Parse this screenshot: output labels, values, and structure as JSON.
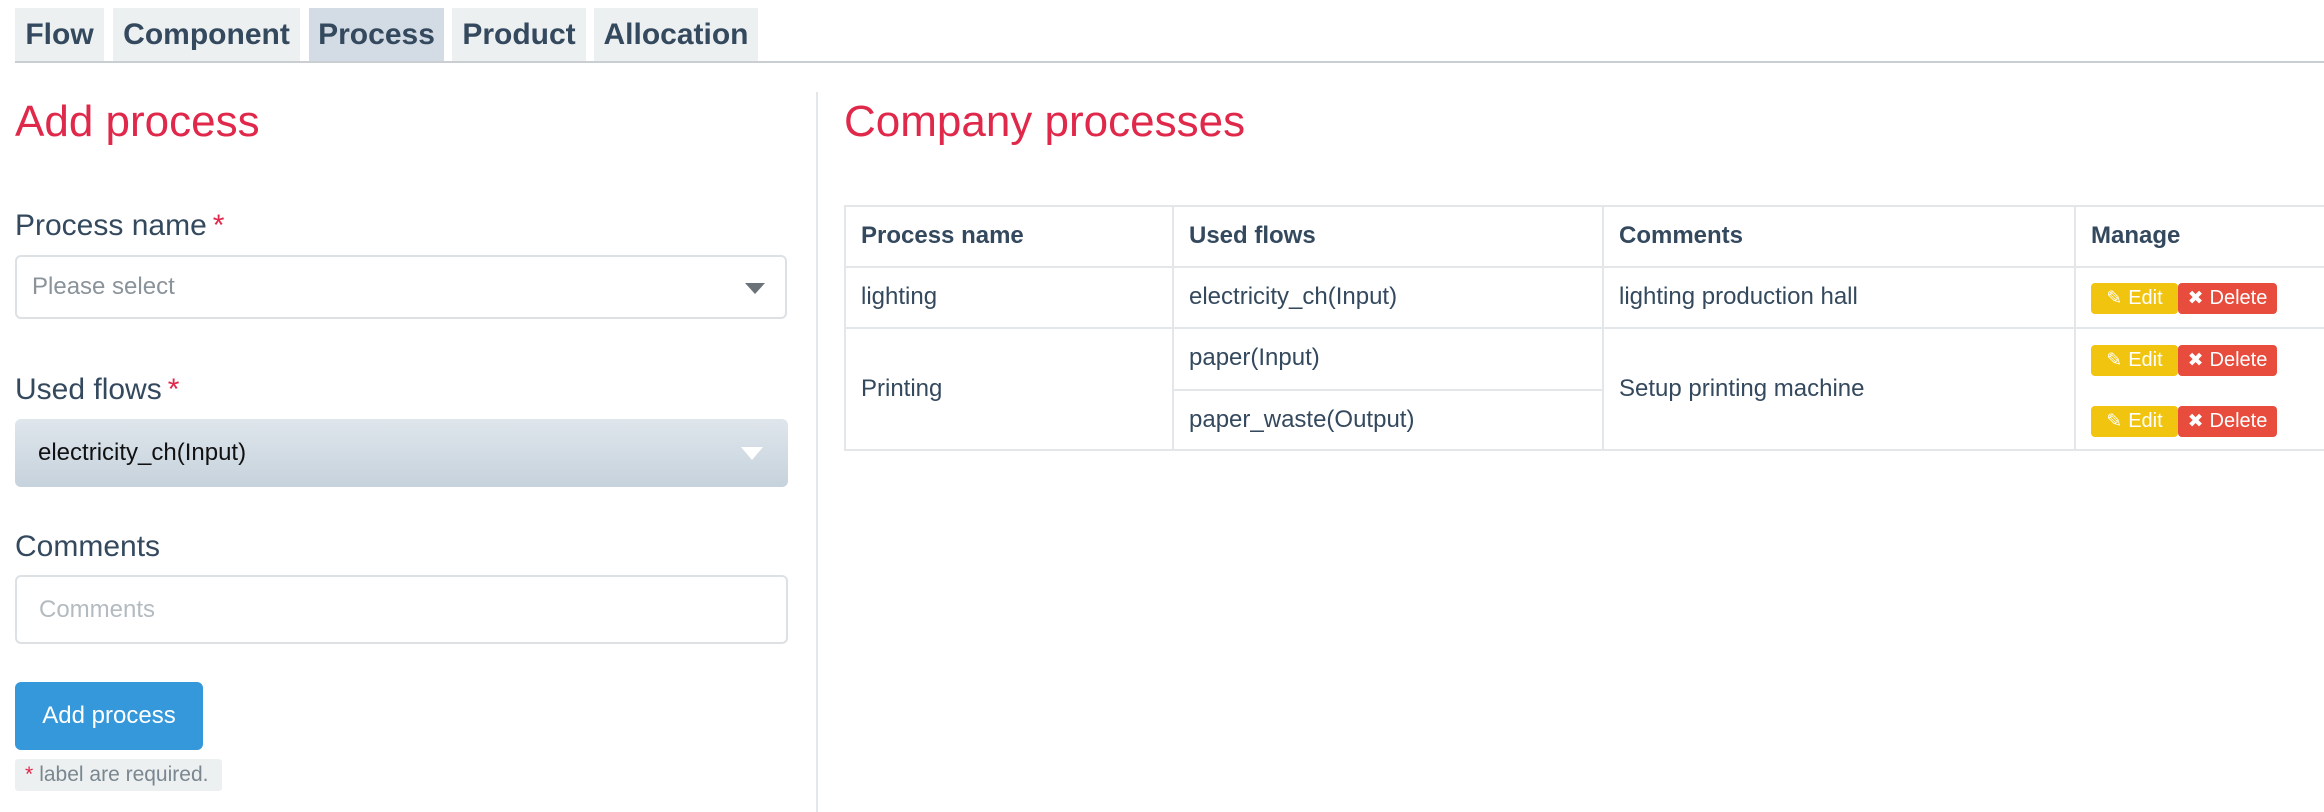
{
  "tabs": [
    {
      "label": "Flow"
    },
    {
      "label": "Component"
    },
    {
      "label": "Process"
    },
    {
      "label": "Product"
    },
    {
      "label": "Allocation"
    }
  ],
  "active_tab": "Process",
  "form": {
    "title": "Add process",
    "process_name": {
      "label": "Process name",
      "required_mark": "*",
      "placeholder": "Please select"
    },
    "used_flows": {
      "label": "Used flows",
      "required_mark": "*",
      "value": "electricity_ch(Input)"
    },
    "comments": {
      "label": "Comments",
      "placeholder": "Comments"
    },
    "submit_label": "Add process",
    "required_note": {
      "mark": "*",
      "text": "label are required."
    }
  },
  "company": {
    "title": "Company processes",
    "table": {
      "headers": [
        "Process name",
        "Used flows",
        "Comments",
        "Manage"
      ],
      "rows": [
        {
          "process": "lighting",
          "comments": "lighting production hall",
          "flows": [
            "electricity_ch(Input)"
          ]
        },
        {
          "process": "Printing",
          "comments": "Setup printing machine",
          "flows": [
            "paper(Input)",
            "paper_waste(Output)"
          ]
        }
      ],
      "edit_label": "Edit",
      "delete_label": "Delete"
    }
  },
  "colors": {
    "heading_red": "#e0284a",
    "primary_blue": "#3498db",
    "edit_yellow": "#f1c40f",
    "delete_red": "#e74c3c",
    "tab_bg": "#ecf0f1",
    "tab_active_bg": "#d3dce4"
  },
  "icons": {
    "edit": "edit-icon",
    "delete": "close-icon",
    "select_caret": "chevron-down-icon"
  }
}
